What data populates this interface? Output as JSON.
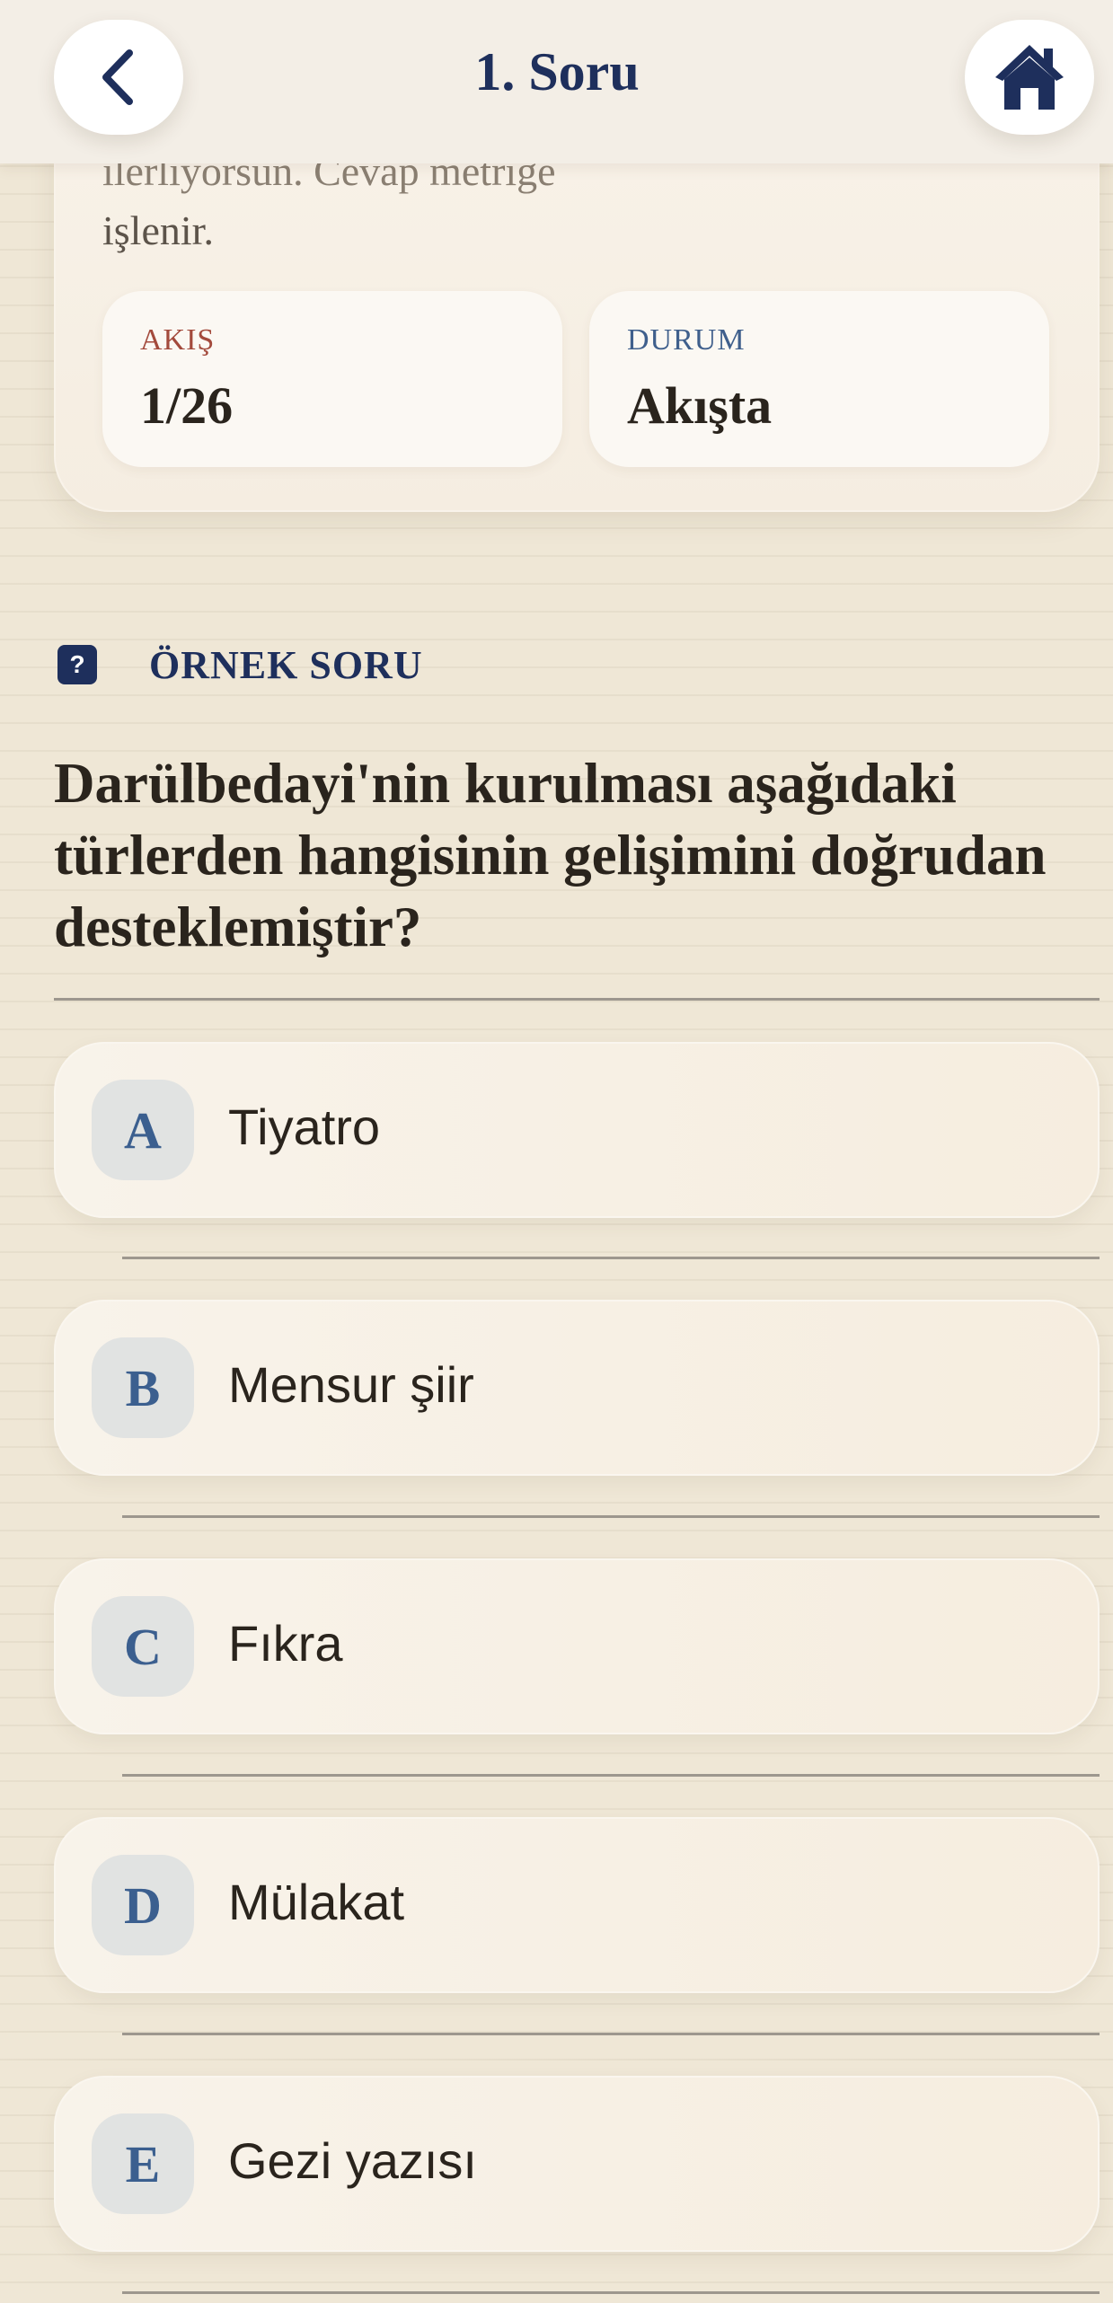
{
  "header": {
    "title": "1. Soru",
    "back_icon": "chevron-left-icon",
    "home_icon": "home-icon"
  },
  "status": {
    "text_cut": "ilerliyorsun. Cevap metriğe",
    "text_line": "işlenir.",
    "flow_label": "AKIŞ",
    "flow_value": "1/26",
    "state_label": "DURUM",
    "state_value": "Akışta"
  },
  "section": {
    "badge": "?",
    "label": "ÖRNEK SORU"
  },
  "question": "Darülbedayi'nin kurulması aşağıdaki türlerden hangisinin gelişimini doğrudan desteklemiştir?",
  "options": [
    {
      "letter": "A",
      "text": "Tiyatro"
    },
    {
      "letter": "B",
      "text": "Mensur şiir"
    },
    {
      "letter": "C",
      "text": "Fıkra"
    },
    {
      "letter": "D",
      "text": "Mülakat"
    },
    {
      "letter": "E",
      "text": "Gezi yazısı"
    }
  ],
  "colors": {
    "accent_navy": "#1e2f5c",
    "flow_label": "#a34a3c",
    "state_label": "#3f5f8c",
    "background": "#efe7d6"
  }
}
